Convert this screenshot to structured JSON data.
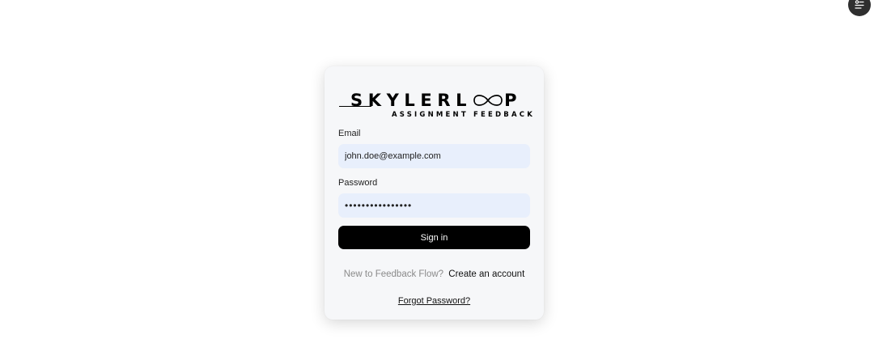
{
  "brand": {
    "name": "SKYLERLOOP",
    "name_before_loop": "SKYLERL",
    "name_after_loop": "P",
    "tagline": "ASSIGNMENT FEEDBACK"
  },
  "floating_button": {
    "icon": "settings-sliders-icon"
  },
  "form": {
    "email": {
      "label": "Email",
      "value": "john.doe@example.com"
    },
    "password": {
      "label": "Password",
      "value": "••••••••••••••••"
    },
    "submit_label": "Sign in"
  },
  "signup": {
    "prompt": "New to Feedback Flow?",
    "link_label": "Create an account"
  },
  "forgot": {
    "link_label": "Forgot Password?"
  },
  "colors": {
    "card_background": "#f6f7f9",
    "input_background": "#e8effc",
    "button_background": "#000000",
    "muted_text": "#8a8a8a"
  }
}
